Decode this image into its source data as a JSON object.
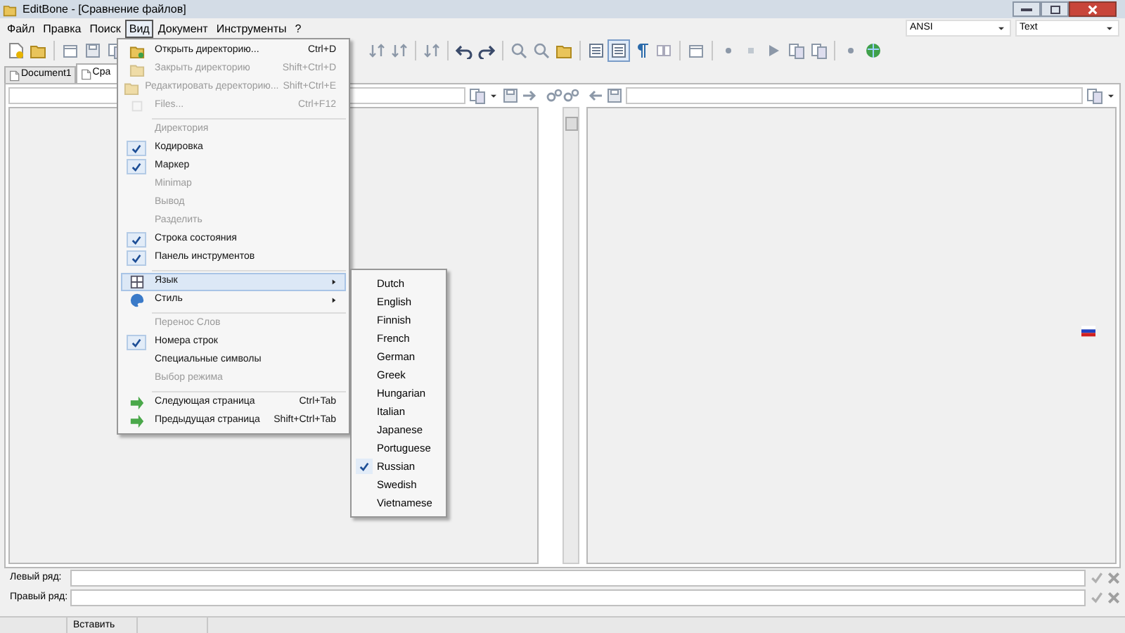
{
  "window": {
    "title": "EditBone - [Сравнение файлов]"
  },
  "menu_bar": [
    {
      "label": "Файл",
      "selected": false
    },
    {
      "label": "Правка",
      "selected": false
    },
    {
      "label": "Поиск",
      "selected": false
    },
    {
      "label": "Вид",
      "selected": true
    },
    {
      "label": "Документ",
      "selected": false
    },
    {
      "label": "Инструменты",
      "selected": false
    },
    {
      "label": "?",
      "selected": false
    }
  ],
  "encoding_combo": {
    "value": "ANSI"
  },
  "highlighter_combo": {
    "value": "Text"
  },
  "tabs": [
    {
      "label": "Document1",
      "selected": false
    },
    {
      "label": "Сра",
      "selected": true
    }
  ],
  "view_menu": {
    "items": [
      {
        "kind": "item",
        "label": "Открыть директорию...",
        "shortcut": "Ctrl+D",
        "disabled": false,
        "checked": false,
        "selected": false,
        "submenu": false
      },
      {
        "kind": "item",
        "label": "Закрыть директорию",
        "shortcut": "Shift+Ctrl+D",
        "disabled": true,
        "checked": false,
        "selected": false,
        "submenu": false
      },
      {
        "kind": "item",
        "label": "Редактировать деректорию...",
        "shortcut": "Shift+Ctrl+E",
        "disabled": true,
        "checked": false,
        "selected": false,
        "submenu": false
      },
      {
        "kind": "item",
        "label": "Files...",
        "shortcut": "Ctrl+F12",
        "disabled": true,
        "checked": false,
        "selected": false,
        "submenu": false
      },
      {
        "kind": "separator"
      },
      {
        "kind": "item",
        "label": "Директория",
        "disabled": true,
        "checked": false,
        "selected": false,
        "submenu": false
      },
      {
        "kind": "item",
        "label": "Кодировка",
        "disabled": false,
        "checked": true,
        "selected": false,
        "submenu": false
      },
      {
        "kind": "item",
        "label": "Маркер",
        "disabled": false,
        "checked": true,
        "selected": false,
        "submenu": false
      },
      {
        "kind": "item",
        "label": "Minimap",
        "disabled": true,
        "checked": false,
        "selected": false,
        "submenu": false
      },
      {
        "kind": "item",
        "label": "Вывод",
        "disabled": true,
        "checked": false,
        "selected": false,
        "submenu": false
      },
      {
        "kind": "item",
        "label": "Разделить",
        "disabled": true,
        "checked": false,
        "selected": false,
        "submenu": false
      },
      {
        "kind": "item",
        "label": "Строка состояния",
        "disabled": false,
        "checked": true,
        "selected": false,
        "submenu": false
      },
      {
        "kind": "item",
        "label": "Панель инструментов",
        "disabled": false,
        "checked": true,
        "selected": false,
        "submenu": false
      },
      {
        "kind": "separator"
      },
      {
        "kind": "item",
        "label": "Язык",
        "disabled": false,
        "checked": false,
        "selected": true,
        "submenu": true
      },
      {
        "kind": "item",
        "label": "Стиль",
        "disabled": false,
        "checked": false,
        "selected": false,
        "submenu": true
      },
      {
        "kind": "separator"
      },
      {
        "kind": "item",
        "label": "Перенос Слов",
        "disabled": true,
        "checked": false,
        "selected": false,
        "submenu": false
      },
      {
        "kind": "item",
        "label": "Номера строк",
        "disabled": false,
        "checked": true,
        "selected": false,
        "submenu": false
      },
      {
        "kind": "item",
        "label": "Специальные символы",
        "disabled": false,
        "checked": false,
        "selected": false,
        "submenu": false
      },
      {
        "kind": "item",
        "label": "Выбор режима",
        "disabled": true,
        "checked": false,
        "selected": false,
        "submenu": false
      },
      {
        "kind": "separator"
      },
      {
        "kind": "item",
        "label": "Следующая страница",
        "shortcut": "Ctrl+Tab",
        "disabled": false,
        "checked": false,
        "selected": false,
        "submenu": false
      },
      {
        "kind": "item",
        "label": "Предыдущая страница",
        "shortcut": "Shift+Ctrl+Tab",
        "disabled": false,
        "checked": false,
        "selected": false,
        "submenu": false
      }
    ]
  },
  "language_submenu": {
    "items": [
      {
        "label": "Dutch",
        "checked": false
      },
      {
        "label": "English",
        "checked": false
      },
      {
        "label": "Finnish",
        "checked": false
      },
      {
        "label": "French",
        "checked": false
      },
      {
        "label": "German",
        "checked": false
      },
      {
        "label": "Greek",
        "checked": false
      },
      {
        "label": "Hungarian",
        "checked": false
      },
      {
        "label": "Italian",
        "checked": false
      },
      {
        "label": "Japanese",
        "checked": false
      },
      {
        "label": "Portuguese",
        "checked": false
      },
      {
        "label": "Russian",
        "checked": true
      },
      {
        "label": "Swedish",
        "checked": false
      },
      {
        "label": "Vietnamese",
        "checked": false
      }
    ]
  },
  "compare_rows": [
    {
      "label": "Левый ряд:"
    },
    {
      "label": "Правый ряд:"
    }
  ],
  "status_bar": {
    "mode": "Вставить"
  }
}
